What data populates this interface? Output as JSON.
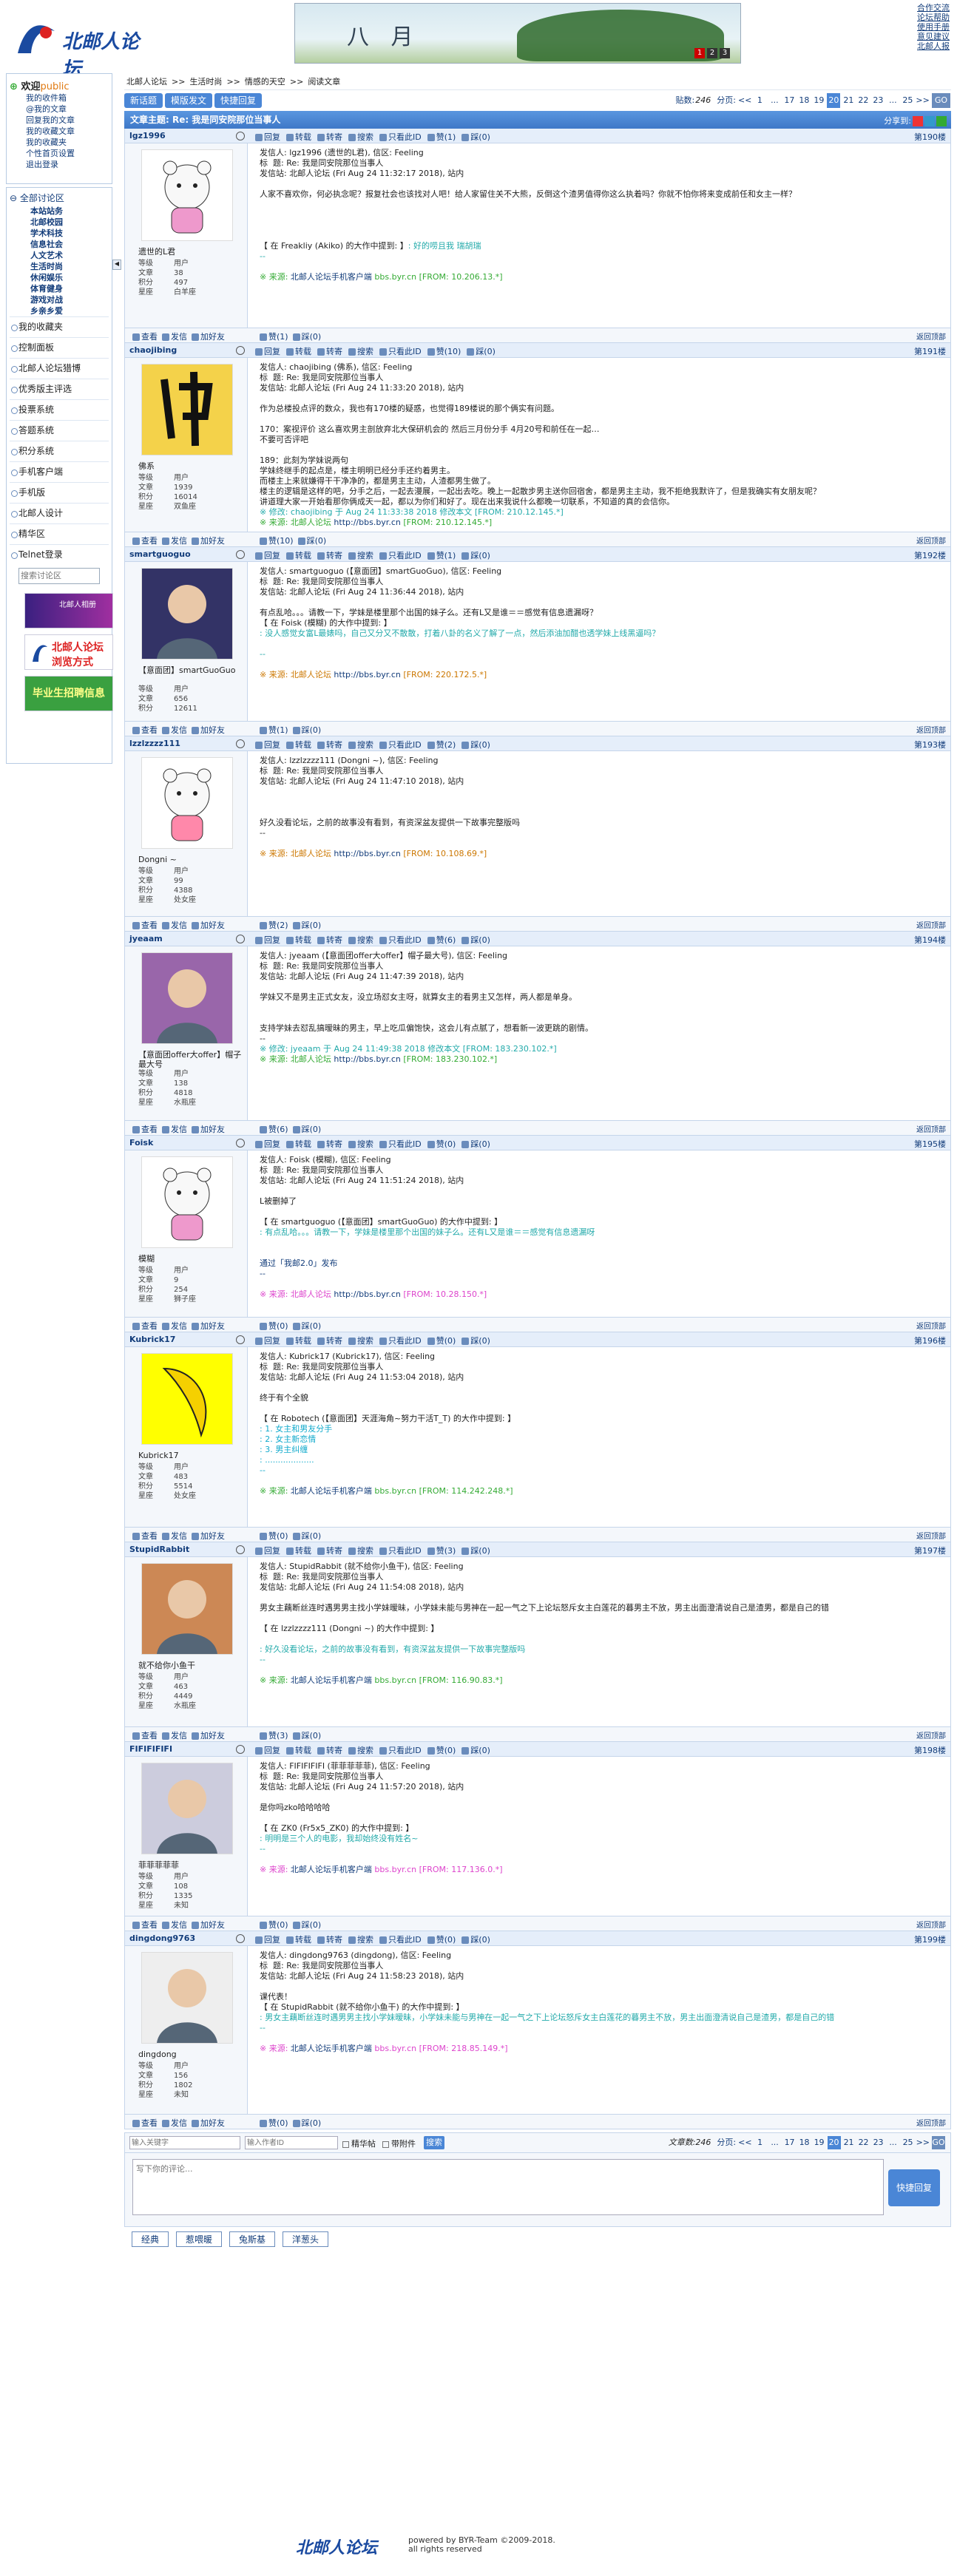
{
  "site": {
    "logo": "北邮人论坛",
    "toplinks": [
      "合作交流",
      "论坛帮助",
      "使用手册",
      "意见建议",
      "北邮人报"
    ],
    "banner": "八 月",
    "banner_dots": [
      "1",
      "2",
      "3"
    ]
  },
  "welcome": {
    "title": "欢迎",
    "user": "public",
    "links": [
      "我的收件箱",
      "@我的文章",
      "回复我的文章",
      "我的收藏文章",
      "我的收藏夹",
      "个性首页设置",
      "退出登录"
    ]
  },
  "nav": {
    "all": "全部讨论区",
    "boards": [
      "本站站务",
      "北邮校园",
      "学术科技",
      "信息社会",
      "人文艺术",
      "生活时尚",
      "休闲娱乐",
      "体育健身",
      "游戏对战",
      "乡亲乡爱"
    ],
    "rows": [
      "我的收藏夹",
      "控制面板",
      "北邮人论坛猎博",
      "优秀版主评选",
      "投票系统",
      "答题系统",
      "积分系统",
      "手机客户端",
      "手机版",
      "北邮人设计",
      "精华区",
      "Telnet登录"
    ],
    "search_placeholder": "搜索讨论区",
    "ads": [
      "北邮人相册",
      "北邮人论坛 浏览方式",
      "毕业生招聘信息"
    ]
  },
  "breadcrumb": [
    "北邮人论坛",
    ">>",
    "生活时尚",
    ">>",
    "情感的天空",
    ">>",
    "阅读文章"
  ],
  "toolbar": {
    "new_label": "新话题",
    "tmpl_label": "模版发文",
    "quick_label": "快捷回复",
    "count_label": "贴数:",
    "count": "246",
    "pages_label": "分页:",
    "pages": [
      "<<",
      "1",
      "...",
      "17",
      "18",
      "19",
      "20",
      "21",
      "22",
      "23",
      "...",
      "25",
      ">>"
    ],
    "current": "20",
    "go": "GO"
  },
  "topic": {
    "title": "文章主题: Re: 我是同安院那位当事人",
    "share": "分享到:"
  },
  "post_ops": [
    "回复",
    "转载",
    "转寄",
    "搜索",
    "只看此ID"
  ],
  "foot_ops": [
    "查看",
    "发信",
    "加好友"
  ],
  "back_top": "返回顶部",
  "labels": {
    "level": "等级",
    "posts": "文章",
    "score": "积分",
    "star": "星座"
  },
  "posts": [
    {
      "id": "lgz1996",
      "floor": "第190楼",
      "nick": "遗世的L君",
      "level": "用户",
      "num": "38",
      "score": "497",
      "star": "白羊座",
      "zan": "(1)",
      "cai": "(0)",
      "top_zan": "赞(1)",
      "top_cai": "踩(0)",
      "content": [
        [
          "",
          "发信人: lgz1996 (遗世的L君), 信区: Feeling\n标  题: Re: 我是同安院那位当事人\n发信站: 北邮人论坛 (Fri Aug 24 11:32:17 2018), 站内\n\n人家不喜欢你，何必执念呢？报复社会也该找对人吧！给人家留住关不大熊，反倒这个渣男值得你这么执着吗？你就不怕你将来变成前任和女主一样？\n\n\n\n\n【 在 Freakliy (Akiko) 的大作中提到: 】"
        ],
        [
          "c-teal",
          ": 好的唠且我 瑞胡瑞\n--\n\n"
        ],
        [
          "c-green",
          "※ 来源: "
        ],
        [
          "c-blue",
          "北邮人论坛手机客户端 "
        ],
        [
          "c-green",
          "bbs.byr.cn [FROM: 10.206.13.*]"
        ]
      ]
    },
    {
      "id": "chaojibing",
      "floor": "第191楼",
      "nick": "佛系",
      "level": "用户",
      "num": "1939",
      "score": "16014",
      "star": "双鱼座",
      "zan": "(0)",
      "cai": "(0)",
      "top_zan": "赞(10)",
      "top_cai": "踩(0)",
      "content": [
        [
          "",
          "发信人: chaojibing (佛系), 信区: Feeling\n标  题: Re: 我是同安院那位当事人\n发信站: 北邮人论坛 (Fri Aug 24 11:33:20 2018), 站内\n\n作为总楼投点评的数众，我也有170楼的疑惑，也觉得189楼说的那个俩实有问题。\n\n170：案视评价 这么喜欢男主剖放弃北大保研机会的 然后三月份分手 4月20号和前任在一起…\n不要可否评吧\n\n189：此刻为学妹说两句\n学妹终继手的起点是，楼主明明已经分手还约着男主。\n而楼主上来就嫌得干干净净的，都是男主主动，人渣都男生做了。\n楼主的逻辑是这样的吧，分手之后，一起去漫展，一起出去吃。晚上一起散步男主送你回宿舍，都是男主主动，我不拒绝我默许了，但是我确实有女朋友呢？\n讲道理大家一开始看那你俩成天一起，都以为你们和好了。现在出来我说什么都晚一切联系，不知道的真的会信你。\n"
        ],
        [
          "c-teal",
          "※ 修改: chaojibing 于 Aug 24 11:33:38 2018 修改本文 [FROM: 210.12.145.*]\n"
        ],
        [
          "c-green",
          "※ 来源: 北邮人论坛 "
        ],
        [
          "c-blue",
          "http://bbs.byr.cn "
        ],
        [
          "c-green",
          "[FROM: 210.12.145.*]"
        ]
      ]
    },
    {
      "id": "smartguoguo",
      "floor": "第192楼",
      "nick": "【意面团】smartGuoGuo",
      "level": "用户",
      "num": "656",
      "score": "12611",
      "star": "",
      "zan": "(0)",
      "cai": "(0)",
      "top_zan": "赞(1)",
      "top_cai": "踩(0)",
      "content": [
        [
          "",
          "发信人: smartguoguo (【意面团】smartGuoGuo), 信区: Feeling\n标  题: Re: 我是同安院那位当事人\n发信站: 北邮人论坛 (Fri Aug 24 11:36:44 2018), 站内\n\n有点乱哈。。。请教一下，学妹是楼里那个出国的妹子么。还有L又是谁＝＝感觉有信息遗漏呀？\n【 在 Foisk (模糊) 的大作中提到: 】\n"
        ],
        [
          "c-teal",
          ": 没人感觉女富L最婊吗，自己又分又不散散，打着八卦的名义了解了一点，然后添油加醋也透学妹上线黑逼吗？\n\n--\n\n"
        ],
        [
          "c-orange",
          "※ 来源: 北邮人论坛 "
        ],
        [
          "c-blue",
          "http://bbs.byr.cn "
        ],
        [
          "c-orange",
          "[FROM: 220.172.5.*]"
        ]
      ]
    },
    {
      "id": "lzzlzzzz111",
      "floor": "第193楼",
      "nick": "Dongni ~",
      "level": "用户",
      "num": "99",
      "score": "4388",
      "star": "处女座",
      "zan": "(2)",
      "cai": "(0)",
      "top_zan": "赞(2)",
      "top_cai": "踩(0)",
      "content": [
        [
          "",
          "发信人: lzzlzzzz111 (Dongni ~), 信区: Feeling\n标  题: Re: 我是同安院那位当事人\n发信站: 北邮人论坛 (Fri Aug 24 11:47:10 2018), 站内\n\n\n\n好久没看论坛，之前的故事没有看到，有资深盆友提供一下故事完整版吗\n--\n\n"
        ],
        [
          "c-orange",
          "※ 来源: 北邮人论坛 "
        ],
        [
          "c-blue",
          "http://bbs.byr.cn "
        ],
        [
          "c-orange",
          "[FROM: 10.108.69.*]"
        ]
      ]
    },
    {
      "id": "jyeaam",
      "floor": "第194楼",
      "nick": "【意面团offer大offer】帽子最大号",
      "level": "用户",
      "num": "138",
      "score": "4818",
      "star": "水瓶座",
      "zan": "(6)",
      "cai": "(0)",
      "top_zan": "赞(6)",
      "top_cai": "踩(0)",
      "content": [
        [
          "",
          "发信人: jyeaam (【意面团offer大offer】帽子最大号), 信区: Feeling\n标  题: Re: 我是同安院那位当事人\n发信站: 北邮人论坛 (Fri Aug 24 11:47:39 2018), 站内\n\n学妹又不是男主正式女友，没立场怼女主呀，就算女主的看男主又怎样，两人都是单身。\n\n\n支持学妹去怼乱搞暧昧的男主，早上吃瓜偏饱快，这会儿有点腻了，想看新一波更跳的剧情。\n--\n"
        ],
        [
          "c-teal",
          "※ 修改: jyeaam 于 Aug 24 11:49:38 2018 修改本文 [FROM: 183.230.102.*]\n"
        ],
        [
          "c-green",
          "※ 来源: 北邮人论坛 "
        ],
        [
          "c-blue",
          "http://bbs.byr.cn "
        ],
        [
          "c-green",
          "[FROM: 183.230.102.*]"
        ]
      ]
    },
    {
      "id": "Foisk",
      "floor": "第195楼",
      "nick": "模糊",
      "level": "用户",
      "num": "9",
      "score": "254",
      "star": "狮子座",
      "zan": "(0)",
      "cai": "(0)",
      "top_zan": "赞(0)",
      "top_cai": "踩(0)",
      "content": [
        [
          "",
          "发信人: Foisk (模糊), 信区: Feeling\n标  题: Re: 我是同安院那位当事人\n发信站: 北邮人论坛 (Fri Aug 24 11:51:24 2018), 站内\n\nL被删掉了\n\n【 在 smartguoguo (【意面团】smartGuoGuo) 的大作中提到: 】\n"
        ],
        [
          "c-teal",
          ": 有点乱哈。。。请教一下，学妹是楼里那个出国的妹子么。还有L又是谁＝＝感觉有信息遗漏呀\n\n\n"
        ],
        [
          "c-blue",
          "通过「我邮2.0」发布\n--\n\n"
        ],
        [
          "c-pink",
          "※ 来源: 北邮人论坛 "
        ],
        [
          "c-blue",
          "http://bbs.byr.cn "
        ],
        [
          "c-pink",
          "[FROM: 10.28.150.*]"
        ]
      ]
    },
    {
      "id": "Kubrick17",
      "floor": "第196楼",
      "nick": "Kubrick17",
      "level": "用户",
      "num": "483",
      "score": "5514",
      "star": "处女座",
      "zan": "(0)",
      "cai": "(0)",
      "top_zan": "赞(0)",
      "top_cai": "踩(0)",
      "content": [
        [
          "",
          "发信人: Kubrick17 (Kubrick17), 信区: Feeling\n标  题: Re: 我是同安院那位当事人\n发信站: 北邮人论坛 (Fri Aug 24 11:53:04 2018), 站内\n\n终于有个全貌\n\n【 在 Robotech (【意面团】天涯海角~努力干活T_T) 的大作中提到: 】\n"
        ],
        [
          "c-cyan",
          ": 1. 女主和男友分手\n: 2. 女主新恋情\n: 3. 男主纠缠\n: ...................\n--\n\n"
        ],
        [
          "c-green",
          "※ 来源: "
        ],
        [
          "c-blue",
          "北邮人论坛手机客户端 "
        ],
        [
          "c-green",
          "bbs.byr.cn [FROM: 114.242.248.*]"
        ]
      ]
    },
    {
      "id": "StupidRabbit",
      "floor": "第197楼",
      "nick": "就不给你小鱼干",
      "level": "用户",
      "num": "463",
      "score": "4449",
      "star": "水瓶座",
      "zan": "(0)",
      "cai": "(0)",
      "top_zan": "赞(3)",
      "top_cai": "踩(0)",
      "content": [
        [
          "",
          "发信人: StupidRabbit (就不给你小鱼干), 信区: Feeling\n标  题: Re: 我是同安院那位当事人\n发信站: 北邮人论坛 (Fri Aug 24 11:54:08 2018), 站内\n\n男女主藕断丝连时遇男男主找小学妹暧昧，小学妹未能与男神在一起一气之下上论坛怒斥女主白莲花的暮男主不放，男主出面澄清说自己是渣男，都是自己的错\n\n【 在 lzzlzzzz111 (Dongni ~) 的大作中提到: 】\n\n"
        ],
        [
          "c-teal",
          ": 好久没看论坛，之前的故事没有看到，有资深盆友提供一下故事完整版吗\n--\n\n"
        ],
        [
          "c-green",
          "※ 来源: "
        ],
        [
          "c-blue",
          "北邮人论坛手机客户端 "
        ],
        [
          "c-green",
          "bbs.byr.cn [FROM: 116.90.83.*]"
        ]
      ]
    },
    {
      "id": "FIFIFIFIFI",
      "floor": "第198楼",
      "nick": "菲菲菲菲菲",
      "level": "用户",
      "num": "108",
      "score": "1335",
      "star": "未知",
      "zan": "(0)",
      "cai": "(0)",
      "top_zan": "赞(0)",
      "top_cai": "踩(0)",
      "content": [
        [
          "",
          "发信人: FIFIFIFIFI (菲菲菲菲菲), 信区: Feeling\n标  题: Re: 我是同安院那位当事人\n发信站: 北邮人论坛 (Fri Aug 24 11:57:20 2018), 站内\n\n是你吗zko哈哈哈哈\n\n【 在 ZK0 (Fr5x5_ZK0) 的大作中提到: 】\n"
        ],
        [
          "c-teal",
          ": 明明是三个人的电影，我却始终没有姓名~\n--\n\n"
        ],
        [
          "c-pink",
          "※ 来源: "
        ],
        [
          "c-blue",
          "北邮人论坛手机客户端 "
        ],
        [
          "c-pink",
          "bbs.byr.cn [FROM: 117.136.0.*]"
        ]
      ]
    },
    {
      "id": "dingdong9763",
      "floor": "第199楼",
      "nick": "dingdong",
      "level": "用户",
      "num": "156",
      "score": "1802",
      "star": "未知",
      "zan": "(0)",
      "cai": "(0)",
      "top_zan": "赞(0)",
      "top_cai": "踩(0)",
      "content": [
        [
          "",
          "发信人: dingdong9763 (dingdong), 信区: Feeling\n标  题: Re: 我是同安院那位当事人\n发信站: 北邮人论坛 (Fri Aug 24 11:58:23 2018), 站内\n\n课代表！\n【 在 StupidRabbit (就不给你小鱼干) 的大作中提到: 】\n"
        ],
        [
          "c-teal",
          ": 男女主藕断丝连时遇男男主找小学妹暧昧，小学妹未能与男神在一起一气之下上论坛怒斥女主白莲花的暮男主不放，男主出面澄清说自己是渣男，都是自己的错\n--\n\n"
        ],
        [
          "c-pink",
          "※ 来源: "
        ],
        [
          "c-blue",
          "北邮人论坛手机客户端 "
        ],
        [
          "c-pink",
          "bbs.byr.cn [FROM: 218.85.149.*]"
        ]
      ]
    }
  ],
  "bottom": {
    "kw_placeholder": "输入关键字",
    "author_placeholder": "输入作者ID",
    "elite": "精华帖",
    "attach": "带附件",
    "search": "搜索",
    "count": "文章数:246",
    "pages_label": "分页:"
  },
  "reply": {
    "placeholder": "写下你的评论...",
    "submit": "快捷回复"
  },
  "tags": [
    "经典",
    "惹喂暖",
    "兔斯基",
    "洋葱头"
  ],
  "footer": {
    "logo": "北邮人论坛",
    "line1": "powered by BYR-Team ©2009-2018.",
    "line2": "all rights reserved"
  }
}
